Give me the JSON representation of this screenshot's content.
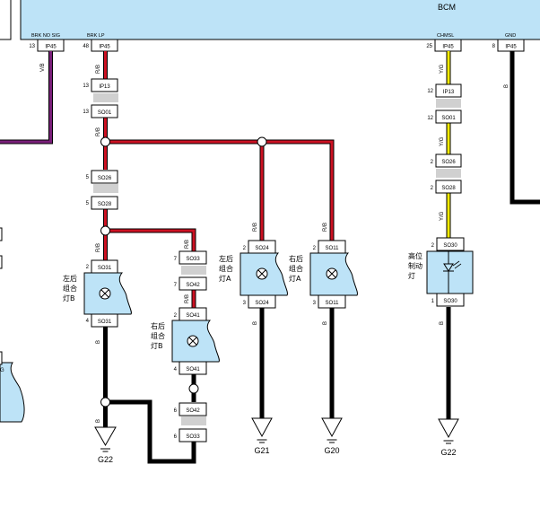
{
  "bcm": {
    "title": "BCM",
    "pins": [
      {
        "num": "13",
        "code": "IP45",
        "name": "BRK NO SIG"
      },
      {
        "num": "48",
        "code": "IP45",
        "name": "BRK LP"
      },
      {
        "num": "25",
        "code": "IP45",
        "name": "CHMSL"
      },
      {
        "num": "8",
        "code": "IP45",
        "name": "GND"
      }
    ]
  },
  "wire_colors": {
    "vb": "V/B",
    "rb": "R/B",
    "yg": "Y/G",
    "b": "B"
  },
  "connectors": {
    "c1": {
      "num": "13",
      "code": "IP13"
    },
    "c2": {
      "num": "13",
      "code": "SO01"
    },
    "c3": {
      "num": "5",
      "code": "SO26"
    },
    "c4": {
      "num": "5",
      "code": "SO28"
    },
    "c5": {
      "num": "2",
      "code": "SO31"
    },
    "c6": {
      "num": "4",
      "code": "SO31"
    },
    "c7": {
      "num": "7",
      "code": "SO33"
    },
    "c8": {
      "num": "7",
      "code": "SO42"
    },
    "c9": {
      "num": "2",
      "code": "SO41"
    },
    "c10": {
      "num": "4",
      "code": "SO41"
    },
    "c11": {
      "num": "6",
      "code": "SO42"
    },
    "c12": {
      "num": "6",
      "code": "SO33"
    },
    "c13": {
      "num": "2",
      "code": "SO24"
    },
    "c14": {
      "num": "3",
      "code": "SO24"
    },
    "c15": {
      "num": "2",
      "code": "SO11"
    },
    "c16": {
      "num": "3",
      "code": "SO11"
    },
    "c17": {
      "num": "12",
      "code": "IP13"
    },
    "c18": {
      "num": "12",
      "code": "SO01"
    },
    "c19": {
      "num": "2",
      "code": "SO26"
    },
    "c20": {
      "num": "2",
      "code": "SO28"
    },
    "c21": {
      "num": "2",
      "code": "SO30"
    },
    "c22": {
      "num": "1",
      "code": "SO30"
    }
  },
  "lamps": {
    "l1": [
      "左后",
      "组合",
      "灯B"
    ],
    "l2": [
      "右后",
      "组合",
      "灯B"
    ],
    "l3": [
      "左后",
      "组合",
      "灯A"
    ],
    "l4": [
      "右后",
      "组合",
      "灯A"
    ],
    "l5": [
      "高位",
      "制动",
      "灯"
    ]
  },
  "grounds": {
    "g1": "G22",
    "g2": "G21",
    "g3": "G20",
    "g4": "G22"
  },
  "partial_text": {
    "g_left": "G"
  },
  "colors": {
    "red": "#cc1122",
    "violet": "#7a1f7a",
    "yellow": "#f2ea00",
    "black": "#000000",
    "component_fill": "#bde3f7",
    "connector_gap": "#d0d0d0"
  }
}
